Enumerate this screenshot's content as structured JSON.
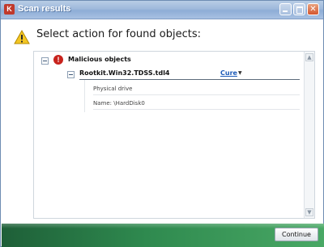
{
  "window": {
    "title": "Scan results"
  },
  "header": {
    "text": "Select action for found objects:"
  },
  "results": {
    "group_label": "Malicious objects",
    "threat": {
      "name": "Rootkit.Win32.TDSS.tdl4",
      "action": "Cure",
      "details": [
        "Physical drive",
        "Name: \\HardDisk0"
      ]
    }
  },
  "footer": {
    "continue_label": "Continue"
  },
  "icons": {
    "app": "kaspersky-k-icon",
    "warning": "warning-triangle-icon",
    "danger": "exclamation-circle-icon"
  },
  "colors": {
    "accent_green": "#2f8a4f",
    "link_blue": "#1d5bb8",
    "danger_red": "#c8231d"
  }
}
